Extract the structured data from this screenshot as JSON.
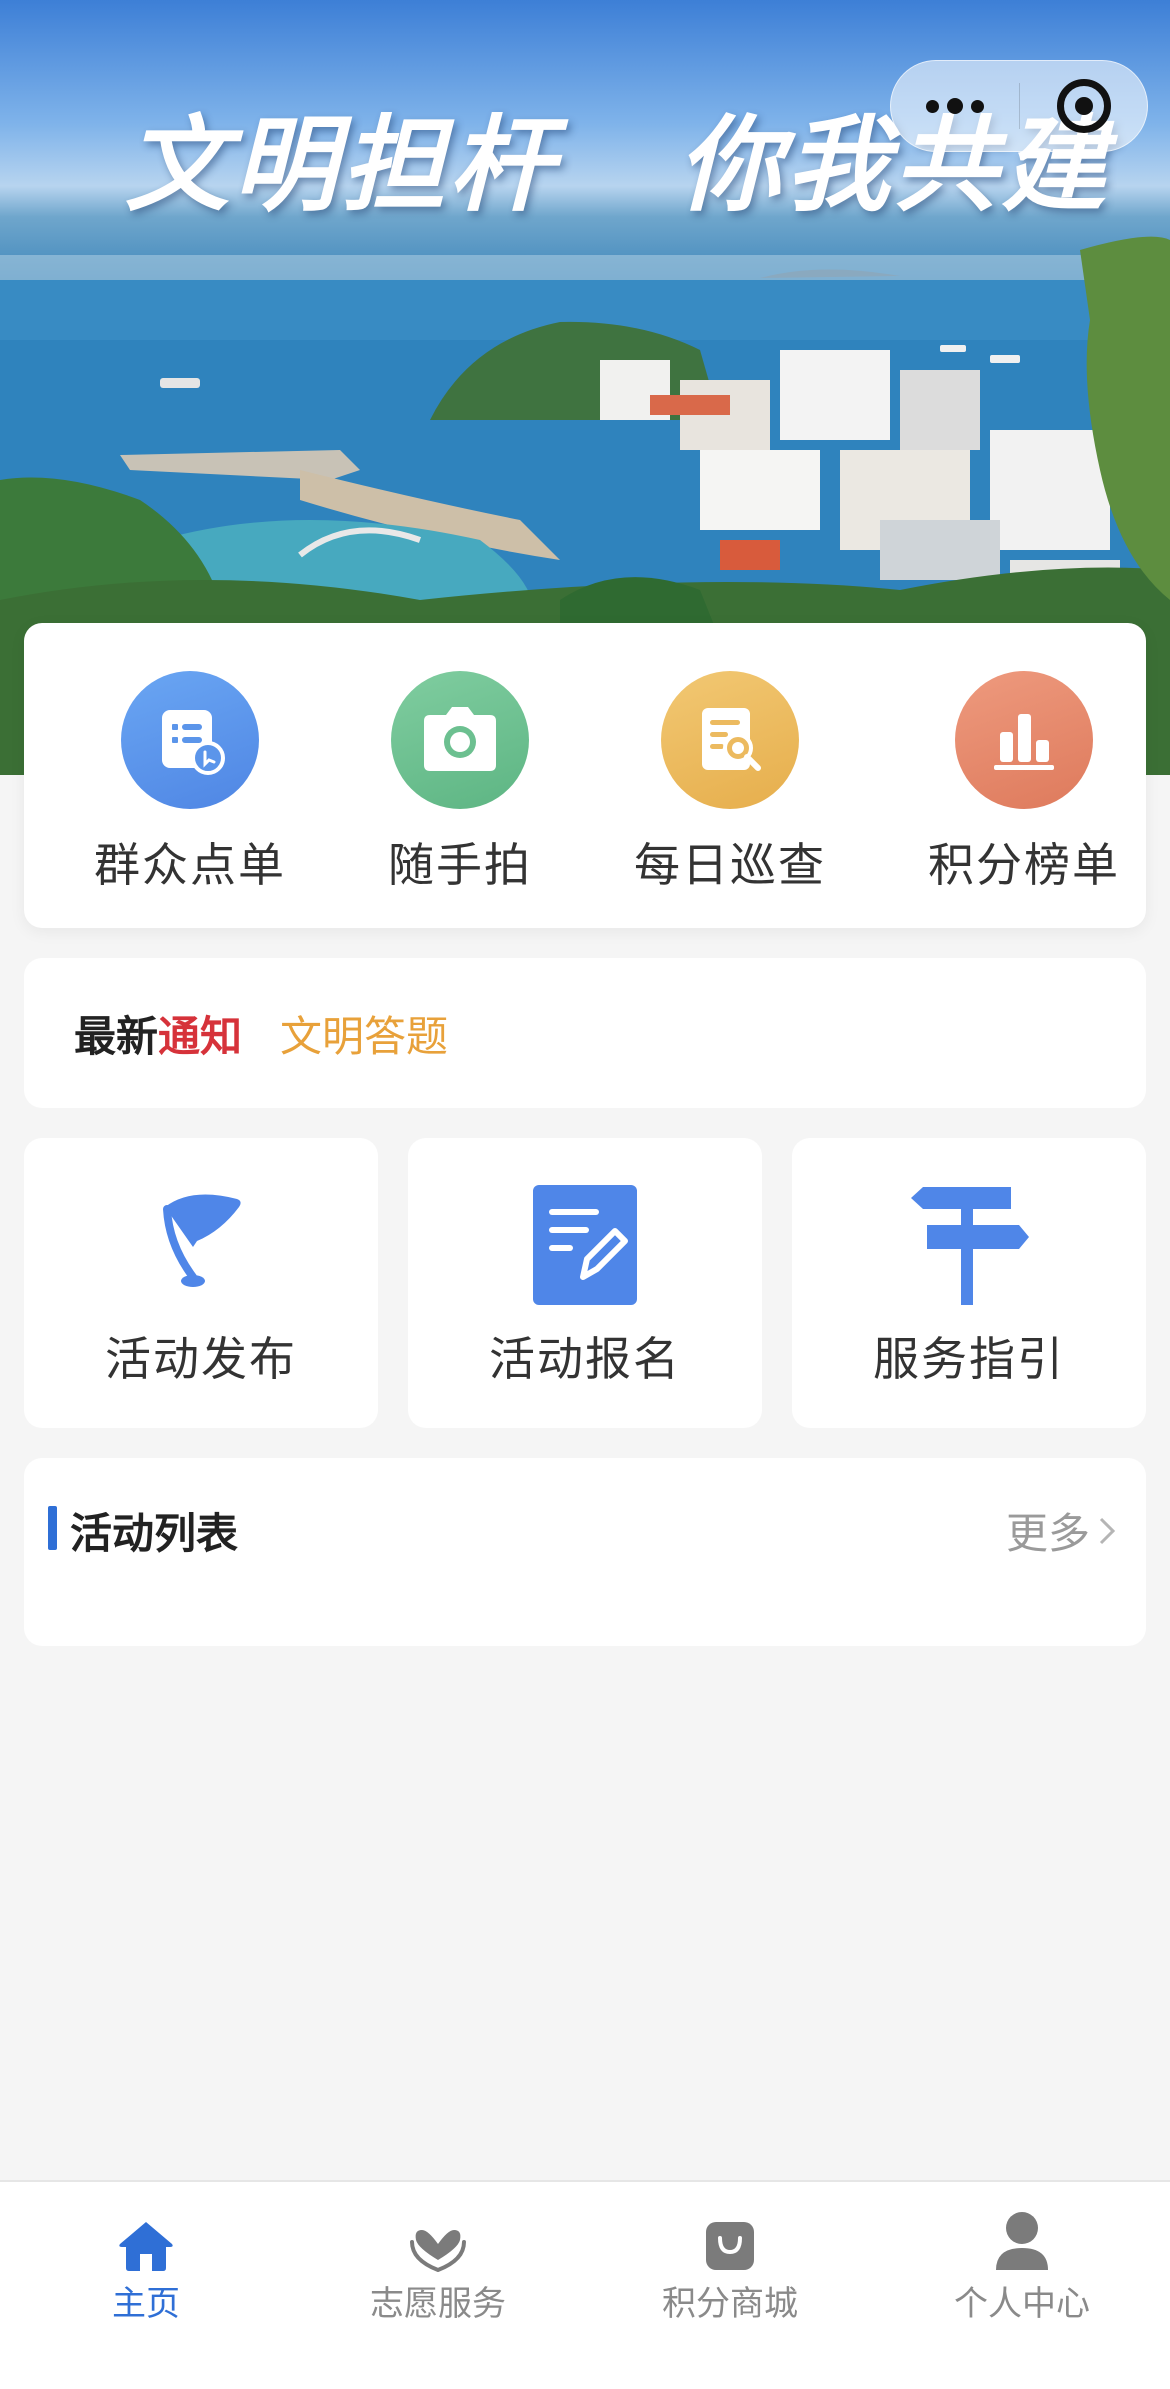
{
  "banner": {
    "slogan": "文明担杆   你我共建"
  },
  "capsule": {
    "more_icon": "more-dots-icon",
    "close_icon": "target-circle-icon"
  },
  "quick_actions": [
    {
      "label": "群众点单",
      "icon": "order-list-icon",
      "color": "#5b95ea"
    },
    {
      "label": "随手拍",
      "icon": "camera-icon",
      "color": "#6cc090"
    },
    {
      "label": "每日巡查",
      "icon": "inspect-document-icon",
      "color": "#ecba5f"
    },
    {
      "label": "积分榜单",
      "icon": "bar-chart-icon",
      "color": "#e58769"
    }
  ],
  "notice": {
    "title_prefix": "最新",
    "title_highlight": "通知",
    "item": "文明答题"
  },
  "services": [
    {
      "label": "活动发布",
      "icon": "flag-icon"
    },
    {
      "label": "活动报名",
      "icon": "edit-form-icon"
    },
    {
      "label": "服务指引",
      "icon": "signpost-icon"
    }
  ],
  "activity_list": {
    "title": "活动列表",
    "more": "更多"
  },
  "tabbar": {
    "active_color": "#2f6fd6",
    "items": [
      {
        "label": "主页",
        "icon": "home-icon",
        "active": true
      },
      {
        "label": "志愿服务",
        "icon": "heart-hands-icon",
        "active": false
      },
      {
        "label": "积分商城",
        "icon": "shopping-bag-icon",
        "active": false
      },
      {
        "label": "个人中心",
        "icon": "person-icon",
        "active": false
      }
    ]
  }
}
